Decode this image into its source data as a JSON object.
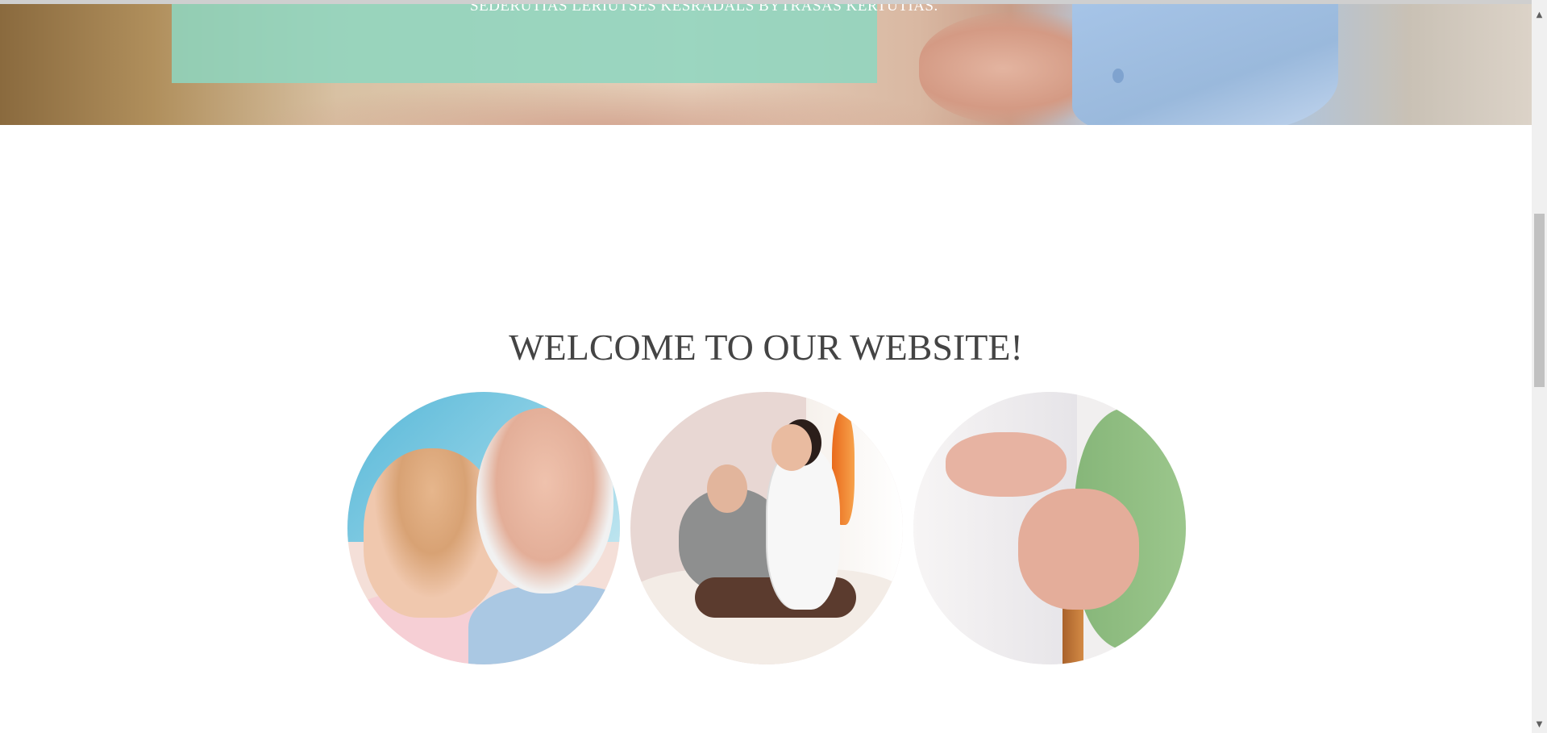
{
  "hero": {
    "caption": "SEDERUTIAS LERIUTSES KESRADALS BYTRASAS KERTUTIAS."
  },
  "welcome": {
    "title": "WELCOME TO OUR WEBSITE!"
  },
  "gallery": {
    "images": [
      {
        "alt": "elderly-couple-photo"
      },
      {
        "alt": "nurse-helping-patient-photo"
      },
      {
        "alt": "hands-on-cane-photo"
      }
    ]
  },
  "scrollbar": {
    "up_arrow": "▲",
    "down_arrow": "▼"
  },
  "colors": {
    "overlay": "#8ED6C0",
    "title_text": "#444444",
    "background": "#FFFFFF"
  }
}
